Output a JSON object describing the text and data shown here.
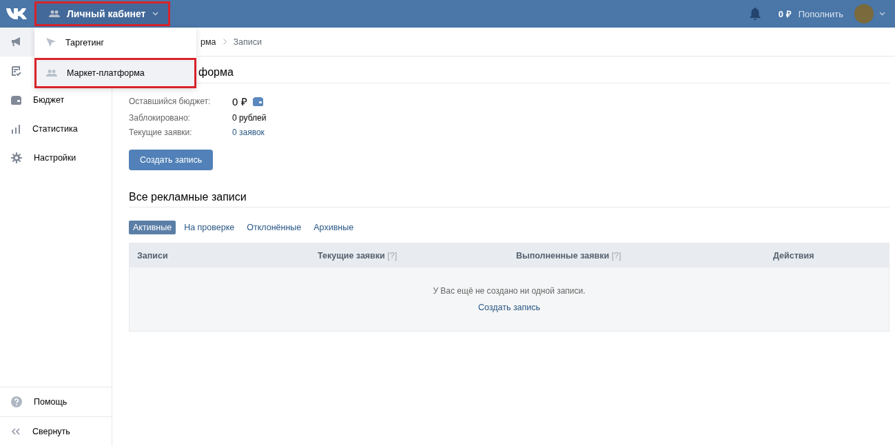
{
  "header": {
    "menu": {
      "label": "Личный кабинет",
      "highlighted": true
    },
    "balance": "0 ₽",
    "topup": "Пополнить"
  },
  "dropdown": [
    {
      "label": "Таргетинг",
      "kind": "cursor",
      "selected": false,
      "highlighted": false
    },
    {
      "label": "Маркет-платформа",
      "kind": "people",
      "selected": true,
      "highlighted": true
    }
  ],
  "sidebar": {
    "items": [
      {
        "kind": "megaphone",
        "selected": true
      },
      {
        "kind": "checklist",
        "selected": false
      },
      {
        "kind": "wallet",
        "label": "Бюджет",
        "selected": false
      },
      {
        "kind": "chart",
        "label": "Статистика",
        "selected": false
      },
      {
        "kind": "gear",
        "label": "Настройки",
        "selected": false
      }
    ],
    "footer": [
      {
        "kind": "help",
        "label": "Помощь"
      },
      {
        "kind": "collapse",
        "label": "Свернуть"
      }
    ]
  },
  "breadcrumb": [
    "рма",
    "Записи"
  ],
  "title": "форма",
  "stats": [
    {
      "label": "Оставшийся бюджет:",
      "value": "0 ₽",
      "kind": "budget"
    },
    {
      "label": "Заблокировано:",
      "value": "0 рублей",
      "kind": "plain"
    },
    {
      "label": "Текущие заявки:",
      "value": "0 заявок",
      "kind": "link"
    }
  ],
  "create_button": "Создать запись",
  "section_title": "Все рекламные записи",
  "tabs": [
    {
      "label": "Активные",
      "selected": true
    },
    {
      "label": "На проверке",
      "selected": false
    },
    {
      "label": "Отклонённые",
      "selected": false
    },
    {
      "label": "Архивные",
      "selected": false
    }
  ],
  "table": {
    "columns": [
      {
        "label": "Записи"
      },
      {
        "label": "Текущие заявки",
        "hint": "[?]"
      },
      {
        "label": "Выполненные заявки",
        "hint": "[?]"
      },
      {
        "label": "Действия"
      }
    ],
    "empty_text": "У Вас ещё не создано ни одной записи.",
    "empty_link": "Создать запись"
  }
}
